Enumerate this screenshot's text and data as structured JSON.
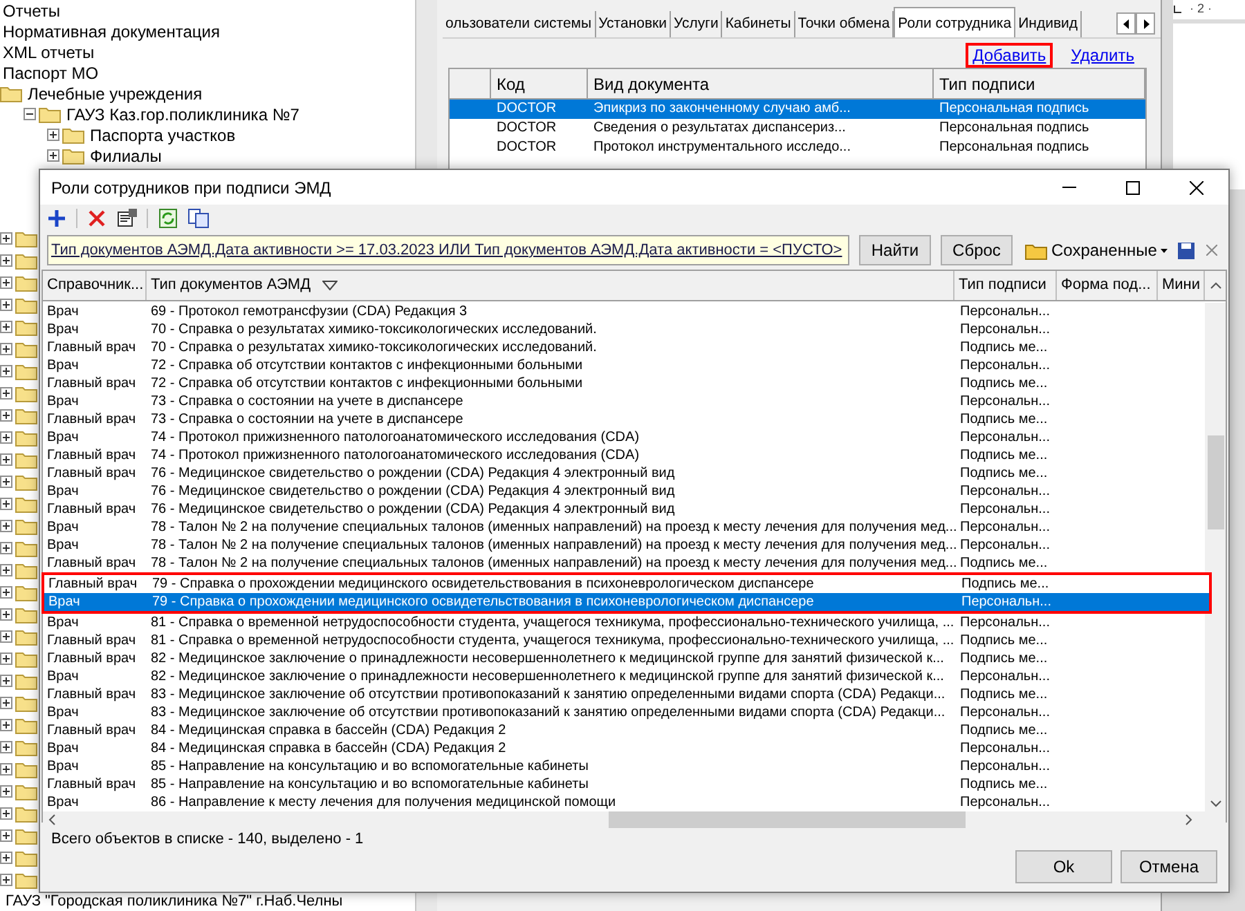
{
  "tree": {
    "items": [
      {
        "label": "Отчеты",
        "kind": "plain"
      },
      {
        "label": "Нормативная документация",
        "kind": "plain"
      },
      {
        "label": "XML отчеты",
        "kind": "plain"
      },
      {
        "label": "Паспорт МО",
        "kind": "plain"
      },
      {
        "label": "Лечебные учреждения",
        "kind": "folder",
        "children": [
          {
            "label": "ГАУЗ Каз.гор.поликлиника №7",
            "kind": "folder",
            "expanded": true,
            "children": [
              {
                "label": "Паспорта участков",
                "kind": "folder",
                "expanded": false
              },
              {
                "label": "Филиалы",
                "kind": "folder",
                "expanded": false
              }
            ]
          }
        ]
      }
    ],
    "footer_item": "ГАУЗ \"Городская поликлиника №7\" г.Наб.Челны"
  },
  "panel": {
    "tabs": [
      {
        "label": "ользователи системы",
        "selected": false
      },
      {
        "label": "Установки",
        "selected": false
      },
      {
        "label": "Услуги",
        "selected": false
      },
      {
        "label": "Кабинеты",
        "selected": false
      },
      {
        "label": "Точки обмена",
        "selected": false
      },
      {
        "label": "Роли сотрудника",
        "selected": true
      },
      {
        "label": "Индивид",
        "selected": false
      }
    ],
    "links": [
      {
        "label": "Добавить",
        "outlined": true
      },
      {
        "label": "Удалить",
        "outlined": false
      }
    ],
    "columns": [
      "Код",
      "Вид документа",
      "Тип подписи"
    ],
    "rows": [
      {
        "code": "DOCTOR",
        "doc": "Эпикриз по законченному случаю амб...",
        "sign": "Персональная подпись",
        "selected": true
      },
      {
        "code": "DOCTOR",
        "doc": "Сведения о результатах диспансериз...",
        "sign": "Персональная подпись",
        "selected": false
      },
      {
        "code": "DOCTOR",
        "doc": "Протокол инструментального исследо...",
        "sign": "Персональная подпись",
        "selected": false
      }
    ]
  },
  "ruler_label": "· 2 ·",
  "dialog": {
    "title": "Роли сотрудников при подписи ЭМД",
    "filter": "Тип документов АЭМД.Дата активности >= 17.03.2023 ИЛИ Тип документов АЭМД.Дата активности = <ПУСТО>",
    "find_button": "Найти",
    "reset_button": "Сброс",
    "saved_label": "Сохраненные",
    "columns": [
      "Справочник...",
      "Тип документов АЭМД",
      "Тип подписи",
      "Форма под...",
      "Мини"
    ],
    "rows": [
      {
        "role": "Врач",
        "doc": "69 - Протокол гемотрансфузии (CDA) Редакция 3",
        "sign": "Персональн...",
        "selected": false,
        "outlined": false
      },
      {
        "role": "Врач",
        "doc": "70 - Справка о результатах химико-токсикологических исследований.",
        "sign": "Персональн...",
        "selected": false,
        "outlined": false
      },
      {
        "role": "Главный врач",
        "doc": "70 - Справка о результатах химико-токсикологических исследований.",
        "sign": "Подпись ме...",
        "selected": false,
        "outlined": false
      },
      {
        "role": "Врач",
        "doc": "72 - Справка об отсутствии контактов с инфекционными больными",
        "sign": "Персональн...",
        "selected": false,
        "outlined": false
      },
      {
        "role": "Главный врач",
        "doc": "72 - Справка об отсутствии контактов с инфекционными больными",
        "sign": "Подпись ме...",
        "selected": false,
        "outlined": false
      },
      {
        "role": "Врач",
        "doc": "73 - Справка о состоянии на учете в диспансере",
        "sign": "Персональн...",
        "selected": false,
        "outlined": false
      },
      {
        "role": "Главный врач",
        "doc": "73 - Справка о состоянии на учете в диспансере",
        "sign": "Подпись ме...",
        "selected": false,
        "outlined": false
      },
      {
        "role": "Врач",
        "doc": "74 - Протокол прижизненного патологоанатомического исследования (CDA)",
        "sign": "Персональн...",
        "selected": false,
        "outlined": false
      },
      {
        "role": "Главный врач",
        "doc": "74 - Протокол прижизненного патологоанатомического исследования (CDA)",
        "sign": "Подпись ме...",
        "selected": false,
        "outlined": false
      },
      {
        "role": "Главный врач",
        "doc": "76 - Медицинское свидетельство о рождении (CDA) Редакция 4 электронный вид",
        "sign": "Подпись ме...",
        "selected": false,
        "outlined": false
      },
      {
        "role": "Врач",
        "doc": "76 - Медицинское свидетельство о рождении (CDA) Редакция 4 электронный вид",
        "sign": "Персональн...",
        "selected": false,
        "outlined": false
      },
      {
        "role": "Главный врач",
        "doc": "76 - Медицинское свидетельство о рождении (CDA) Редакция 4 электронный вид",
        "sign": "Персональн...",
        "selected": false,
        "outlined": false
      },
      {
        "role": "Врач",
        "doc": "78 - Талон № 2 на получение специальных талонов (именных направлений) на проезд к месту лечения для получения мед...",
        "sign": "Персональн...",
        "selected": false,
        "outlined": false
      },
      {
        "role": "Врач",
        "doc": "78 - Талон № 2 на получение специальных талонов (именных направлений) на проезд к месту лечения для получения мед...",
        "sign": "Персональн...",
        "selected": false,
        "outlined": false
      },
      {
        "role": "Главный врач",
        "doc": "78 - Талон № 2 на получение специальных талонов (именных направлений) на проезд к месту лечения для получения мед...",
        "sign": "Подпись ме...",
        "selected": false,
        "outlined": false
      },
      {
        "role": "Главный врач",
        "doc": "79 - Справка о прохождении медицинского освидетельствования в психоневрологическом диспансере",
        "sign": "Подпись ме...",
        "selected": false,
        "outlined": true
      },
      {
        "role": "Врач",
        "doc": "79 - Справка о прохождении медицинского освидетельствования в психоневрологическом диспансере",
        "sign": "Персональн...",
        "selected": true,
        "outlined": true
      },
      {
        "role": "Врач",
        "doc": "81 - Справка о временной нетрудоспособности студента, учащегося техникума, профессионально-технического училища, ...",
        "sign": "Персональн...",
        "selected": false,
        "outlined": false
      },
      {
        "role": "Главный врач",
        "doc": "81 - Справка о временной нетрудоспособности студента, учащегося техникума, профессионально-технического училища, ...",
        "sign": "Подпись ме...",
        "selected": false,
        "outlined": false
      },
      {
        "role": "Главный врач",
        "doc": "82 - Медицинское заключение о принадлежности несовершеннолетнего к медицинской группе для занятий физической к...",
        "sign": "Подпись ме...",
        "selected": false,
        "outlined": false
      },
      {
        "role": "Врач",
        "doc": "82 - Медицинское заключение о принадлежности несовершеннолетнего к медицинской группе для занятий физической к...",
        "sign": "Персональн...",
        "selected": false,
        "outlined": false
      },
      {
        "role": "Главный врач",
        "doc": "83 - Медицинское заключение об отсутствии противопоказаний к занятию определенными видами спорта (CDA) Редакци...",
        "sign": "Подпись ме...",
        "selected": false,
        "outlined": false
      },
      {
        "role": "Врач",
        "doc": "83 - Медицинское заключение об отсутствии противопоказаний к занятию определенными видами спорта (CDA) Редакци...",
        "sign": "Персональн...",
        "selected": false,
        "outlined": false
      },
      {
        "role": "Главный врач",
        "doc": "84 - Медицинская справка в бассейн (CDA) Редакция 2",
        "sign": "Подпись ме...",
        "selected": false,
        "outlined": false
      },
      {
        "role": "Врач",
        "doc": "84 - Медицинская справка в бассейн (CDA) Редакция 2",
        "sign": "Персональн...",
        "selected": false,
        "outlined": false
      },
      {
        "role": "Врач",
        "doc": "85 - Направление на консультацию и во вспомогательные кабинеты",
        "sign": "Персональн...",
        "selected": false,
        "outlined": false
      },
      {
        "role": "Главный врач",
        "doc": "85 - Направление на консультацию и во вспомогательные кабинеты",
        "sign": "Подпись ме...",
        "selected": false,
        "outlined": false
      },
      {
        "role": "Врач",
        "doc": "86 - Направление к месту лечения для получения медицинской помощи",
        "sign": "Персональн...",
        "selected": false,
        "outlined": false
      }
    ],
    "status": "Всего объектов в списке - 140, выделено - 1",
    "ok_button": "Ok",
    "cancel_button": "Отмена"
  }
}
